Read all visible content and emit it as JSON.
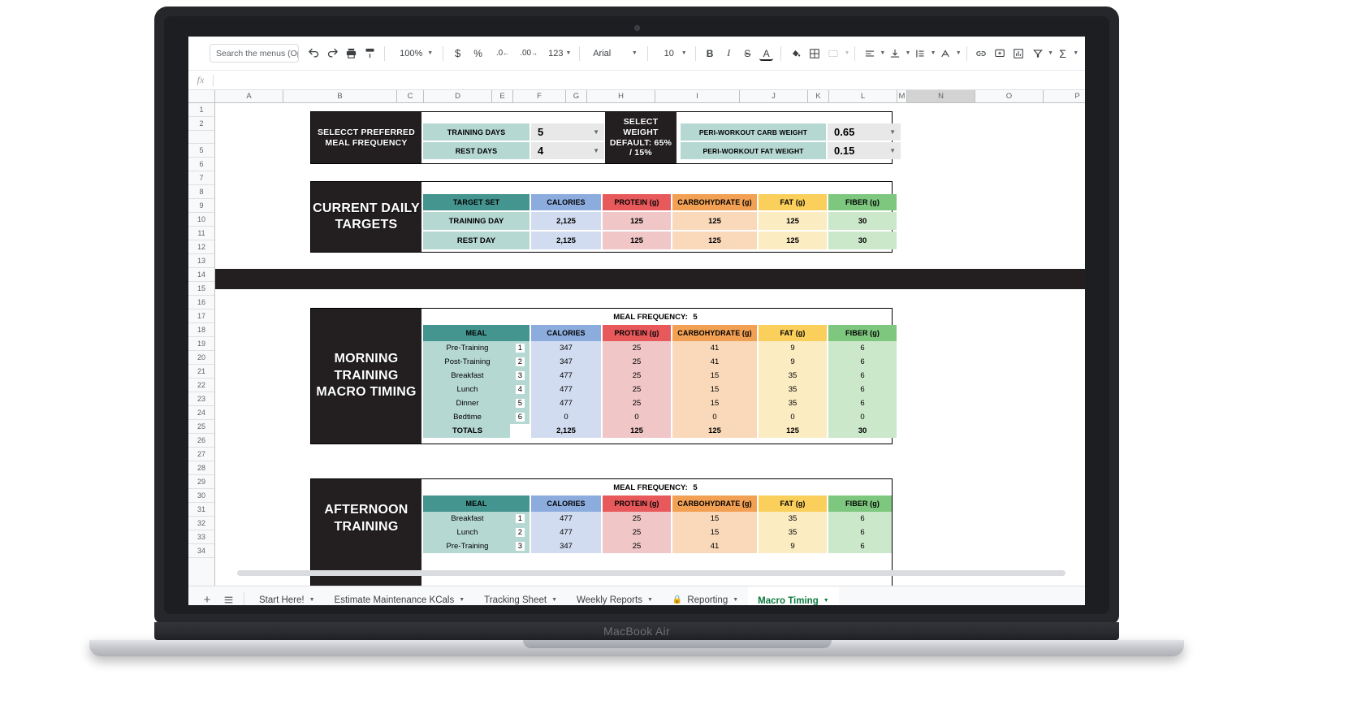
{
  "device": {
    "label": "MacBook Air"
  },
  "toolbar": {
    "search_placeholder": "Search the menus (Option+/)",
    "undo": "↶",
    "redo": "↷",
    "print": "print-icon",
    "paint_format": "paint-format-icon",
    "zoom": "100%",
    "currency": "$",
    "percent": "%",
    "decimal_decrease": ".0",
    "decimal_increase": ".00",
    "number_format": "123",
    "font": "Arial",
    "font_size": "10",
    "bold": "B",
    "italic": "I",
    "strikethrough": "S",
    "text_color": "A",
    "fill_color": "fill-color-icon",
    "borders": "borders-icon",
    "merge_cells": "merge-cells-icon",
    "halign": "align-left-icon",
    "valign": "vertical-align-icon",
    "text_wrap": "text-wrap-icon",
    "text_rotation": "text-rotation-icon",
    "link": "link-icon",
    "comment": "comment-icon",
    "chart": "chart-icon",
    "filter": "filter-icon",
    "functions": "Σ"
  },
  "formula_bar": {
    "fx": "fx",
    "value": ""
  },
  "grid": {
    "columns": [
      "A",
      "B",
      "C",
      "D",
      "E",
      "F",
      "G",
      "H",
      "I",
      "J",
      "K",
      "L",
      "M",
      "N",
      "O",
      "P"
    ],
    "selected_column": "N",
    "rows": [
      "1",
      "2",
      "",
      "5",
      "6",
      "7",
      "8",
      "9",
      "10",
      "11",
      "12",
      "13",
      "14",
      "15",
      "16",
      "17",
      "18",
      "19",
      "20",
      "21",
      "22",
      "23",
      "24",
      "25",
      "26",
      "27",
      "28",
      "29",
      "30",
      "31",
      "32",
      "33",
      "34"
    ]
  },
  "config": {
    "meal_frequency_label": "SELECCT PREFERRED MEAL FREQUENCY",
    "rows": [
      {
        "label": "TRAINING DAYS",
        "value": "5"
      },
      {
        "label": "REST DAYS",
        "value": "4"
      }
    ],
    "weight_default_label": "SELECT WEIGHT DEFAULT: 65% / 15%",
    "weight_rows": [
      {
        "label": "PERI-WORKOUT CARB WEIGHT",
        "value": "0.65"
      },
      {
        "label": "PERI-WORKOUT FAT WEIGHT",
        "value": "0.15"
      }
    ]
  },
  "daily_targets": {
    "title": "CURRENT DAILY TARGETS",
    "headers": [
      "TARGET SET",
      "CALORIES",
      "PROTEIN (g)",
      "CARBOHYDRATE (g)",
      "FAT (g)",
      "FIBER (g)"
    ],
    "rows": [
      {
        "name": "TRAINING DAY",
        "calories": "2,125",
        "protein": "125",
        "carbs": "125",
        "fat": "125",
        "fiber": "30"
      },
      {
        "name": "REST DAY",
        "calories": "2,125",
        "protein": "125",
        "carbs": "125",
        "fat": "125",
        "fiber": "30"
      }
    ]
  },
  "morning": {
    "title": "MORNING TRAINING MACRO TIMING",
    "meal_frequency_label": "MEAL FREQUENCY:",
    "meal_frequency_value": "5",
    "headers": [
      "MEAL",
      "CALORIES",
      "PROTEIN (g)",
      "CARBOHYDRATE (g)",
      "FAT (g)",
      "FIBER (g)"
    ],
    "rows": [
      {
        "meal": "Pre-Training",
        "n": "1",
        "calories": "347",
        "protein": "25",
        "carbs": "41",
        "fat": "9",
        "fiber": "6"
      },
      {
        "meal": "Post-Training",
        "n": "2",
        "calories": "347",
        "protein": "25",
        "carbs": "41",
        "fat": "9",
        "fiber": "6"
      },
      {
        "meal": "Breakfast",
        "n": "3",
        "calories": "477",
        "protein": "25",
        "carbs": "15",
        "fat": "35",
        "fiber": "6"
      },
      {
        "meal": "Lunch",
        "n": "4",
        "calories": "477",
        "protein": "25",
        "carbs": "15",
        "fat": "35",
        "fiber": "6"
      },
      {
        "meal": "Dinner",
        "n": "5",
        "calories": "477",
        "protein": "25",
        "carbs": "15",
        "fat": "35",
        "fiber": "6"
      },
      {
        "meal": "Bedtime",
        "n": "6",
        "calories": "0",
        "protein": "0",
        "carbs": "0",
        "fat": "0",
        "fiber": "0"
      },
      {
        "meal": "TOTALS",
        "n": "",
        "calories": "2,125",
        "protein": "125",
        "carbs": "125",
        "fat": "125",
        "fiber": "30"
      }
    ]
  },
  "afternoon": {
    "title": "AFTERNOON TRAINING",
    "meal_frequency_label": "MEAL FREQUENCY:",
    "meal_frequency_value": "5",
    "headers": [
      "MEAL",
      "CALORIES",
      "PROTEIN (g)",
      "CARBOHYDRATE (g)",
      "FAT (g)",
      "FIBER (g)"
    ],
    "rows": [
      {
        "meal": "Breakfast",
        "n": "1",
        "calories": "477",
        "protein": "25",
        "carbs": "15",
        "fat": "35",
        "fiber": "6"
      },
      {
        "meal": "Lunch",
        "n": "2",
        "calories": "477",
        "protein": "25",
        "carbs": "15",
        "fat": "35",
        "fiber": "6"
      },
      {
        "meal": "Pre-Training",
        "n": "3",
        "calories": "347",
        "protein": "25",
        "carbs": "41",
        "fat": "9",
        "fiber": "6"
      }
    ]
  },
  "sheet_tabs": {
    "add": "+",
    "all_sheets": "all-sheets-icon",
    "tabs": [
      {
        "label": "Start Here!",
        "locked": false,
        "active": false
      },
      {
        "label": "Estimate Maintenance KCals",
        "locked": false,
        "active": false
      },
      {
        "label": "Tracking Sheet",
        "locked": false,
        "active": false
      },
      {
        "label": "Weekly Reports",
        "locked": false,
        "active": false
      },
      {
        "label": "Reporting",
        "locked": true,
        "active": false
      },
      {
        "label": "Macro Timing",
        "locked": false,
        "active": true
      }
    ]
  }
}
